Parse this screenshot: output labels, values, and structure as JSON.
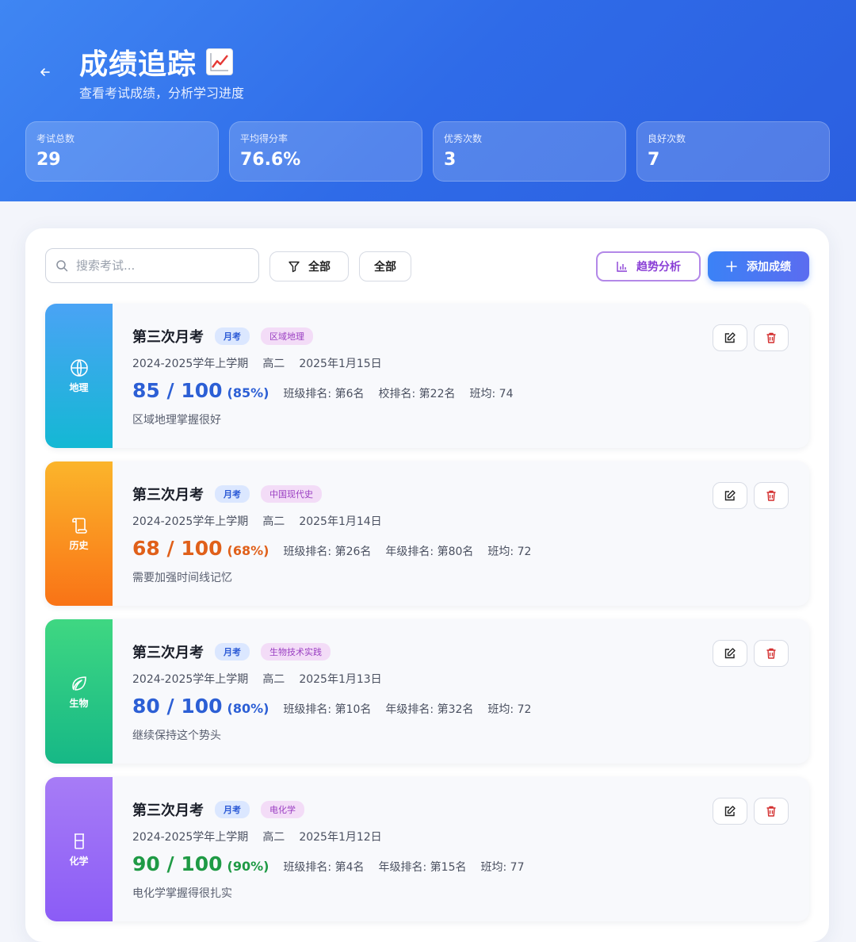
{
  "header": {
    "title": "成绩追踪",
    "subtitle": "查看考试成绩，分析学习进度",
    "back_icon": "arrow-left-icon",
    "title_icon": "chart-increasing-icon"
  },
  "stats": [
    {
      "label": "考试总数",
      "value": "29"
    },
    {
      "label": "平均得分率",
      "value": "76.6%"
    },
    {
      "label": "优秀次数",
      "value": "3"
    },
    {
      "label": "良好次数",
      "value": "7"
    }
  ],
  "toolbar": {
    "search_placeholder": "搜索考试...",
    "filter_label": "全部",
    "filter2_label": "全部",
    "trend_label": "趋势分析",
    "add_label": "添加成绩"
  },
  "colors": {
    "accent_blue": "#3b82f6",
    "trend_purple": "#8a3fd6",
    "score_blue": "#2c5fd5",
    "score_orange": "#e0601a",
    "score_green": "#1f9a45"
  },
  "records": [
    {
      "subject": "地理",
      "subject_icon": "globe-icon",
      "exam": "第三次月考",
      "type": "月考",
      "topic": "区域地理",
      "term": "2024-2025学年上学期",
      "grade": "高二",
      "date": "2025年1月15日",
      "score": "85 / 100",
      "percent": "(85%)",
      "class_rank": "班级排名: 第6名",
      "other_rank": "校排名: 第22名",
      "class_avg": "班均: 74",
      "note": "区域地理掌握很好"
    },
    {
      "subject": "历史",
      "subject_icon": "scroll-icon",
      "exam": "第三次月考",
      "type": "月考",
      "topic": "中国现代史",
      "term": "2024-2025学年上学期",
      "grade": "高二",
      "date": "2025年1月14日",
      "score": "68 / 100",
      "percent": "(68%)",
      "class_rank": "班级排名: 第26名",
      "other_rank": "年级排名: 第80名",
      "class_avg": "班均: 72",
      "note": "需要加强时间线记忆"
    },
    {
      "subject": "生物",
      "subject_icon": "leaf-icon",
      "exam": "第三次月考",
      "type": "月考",
      "topic": "生物技术实践",
      "term": "2024-2025学年上学期",
      "grade": "高二",
      "date": "2025年1月13日",
      "score": "80 / 100",
      "percent": "(80%)",
      "class_rank": "班级排名: 第10名",
      "other_rank": "年级排名: 第32名",
      "class_avg": "班均: 72",
      "note": "继续保持这个势头"
    },
    {
      "subject": "化学",
      "subject_icon": "beaker-icon",
      "exam": "第三次月考",
      "type": "月考",
      "topic": "电化学",
      "term": "2024-2025学年上学期",
      "grade": "高二",
      "date": "2025年1月12日",
      "score": "90 / 100",
      "percent": "(90%)",
      "class_rank": "班级排名: 第4名",
      "other_rank": "年级排名: 第15名",
      "class_avg": "班均: 77",
      "note": "电化学掌握得很扎实"
    }
  ]
}
